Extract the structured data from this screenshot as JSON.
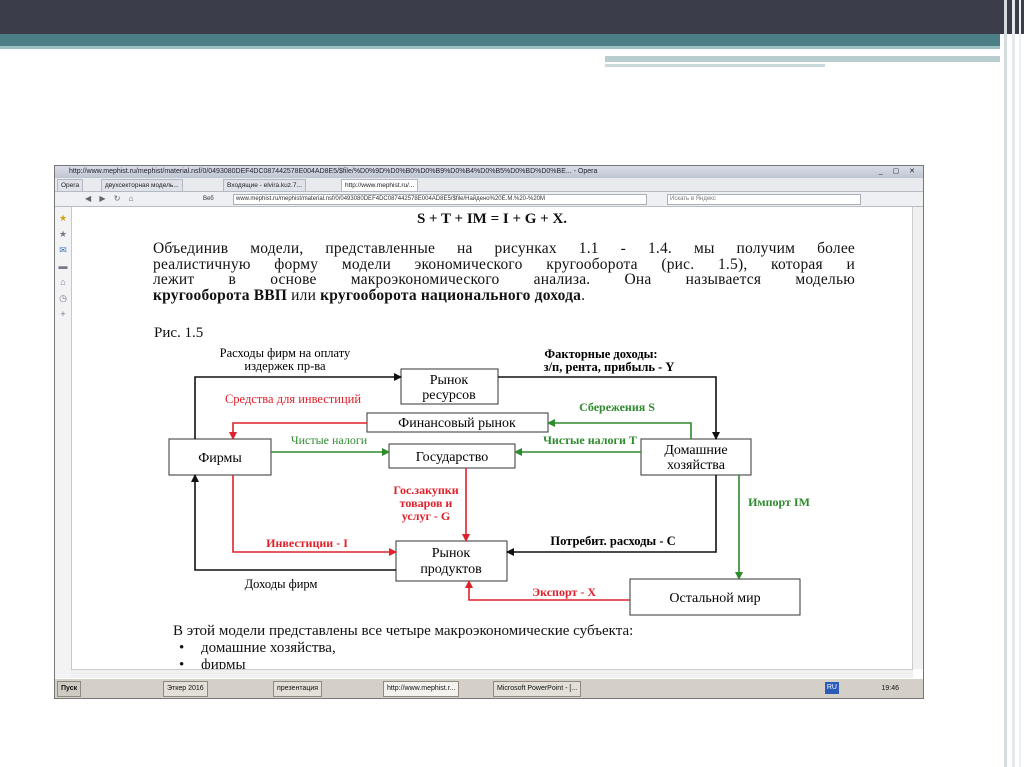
{
  "window": {
    "title": "http://www.mephist.ru/mephist/material.nsf/0/0493080DEF4DC087442578E004AD8E5/$file/%D0%9D%D0%B0%D0%B9%D0%B4%D0%B5%D0%BD%D0%BE... - Opera",
    "controls": "_ ▢ ✕"
  },
  "tabs": [
    {
      "label": "Opera"
    },
    {
      "label": "двухсекторная модель..."
    },
    {
      "label": "Входящие - elvira.kuz.7..."
    },
    {
      "label": "http://www.mephist.ru/..."
    }
  ],
  "address_bar": {
    "nav": "◀ ▶ ↻ ⌂",
    "site_badge": "Веб",
    "url": "www.mephist.ru/mephist/material.nsf/0/0493080DEF4DC087442578E004AD8E5/$file/Найдено%20E.M.%20-%20M",
    "search_placeholder": "Искать в Яндекс"
  },
  "document": {
    "formula": "S + T + IM = I + G + X.",
    "paragraph_lines": [
      "Объединив модели, представленные на рисунках 1.1 - 1.4. мы получим более",
      "реалистичную форму модели экономического кругооборота (рис. 1.5), которая и",
      "лежит в основе макроэкономического анализа. Она называется моделью"
    ],
    "paragraph_last": {
      "bold1": "кругооборота ВВП",
      "mid": " или ",
      "bold2": "кругооборота национального дохода",
      "end": "."
    },
    "figure_label": "Рис. 1.5",
    "bottom_intro": "В этой модели представлены все четыре макроэкономические субъекта:",
    "bullets": [
      "домашние хозяйства,",
      "фирмы"
    ]
  },
  "diagram": {
    "nodes": {
      "resources": [
        "Рынок",
        "ресурсов"
      ],
      "financial": "Финансовый рынок",
      "firms": "Фирмы",
      "government": "Государство",
      "households": [
        "Домашние",
        "хозяйства"
      ],
      "products": [
        "Рынок",
        "продуктов"
      ],
      "rest_world": "Остальной мир"
    },
    "labels": {
      "firm_costs": [
        "Расходы фирм на оплату",
        "издержек пр-ва"
      ],
      "factor_income": [
        "Факторные доходы:",
        "з/п, рента, прибыль - Y"
      ],
      "invest_funds": "Средства для инвестиций",
      "savings": "Сбережения S",
      "net_taxes_firms": "Чистые налоги",
      "net_taxes_t": "Чистые налоги T",
      "gov_purchases": [
        "Гос.закупки",
        "товаров и",
        "услуг - G"
      ],
      "investment": "Инвестиции - I",
      "consumption": "Потребит. расходы - C",
      "import": "Импорт IM",
      "export": "Экспорт - X",
      "firm_income": "Доходы фирм"
    },
    "colors": {
      "black": "#111111",
      "red": "#e0202a",
      "green": "#2d8a2d"
    }
  },
  "taskbar": {
    "start": "Пуск",
    "items": [
      {
        "label": "Эткер 2016"
      },
      {
        "label": "презентация"
      },
      {
        "label": "http://www.mephist.r..."
      },
      {
        "label": "Microsoft PowerPoint - [..."
      }
    ],
    "lang": "RU",
    "clock": "19:46"
  },
  "sidebar_icons": [
    "bookmarks-icon",
    "favorites-icon",
    "mail-icon",
    "notes-icon",
    "downloads-icon",
    "history-icon",
    "add-panel-icon"
  ]
}
